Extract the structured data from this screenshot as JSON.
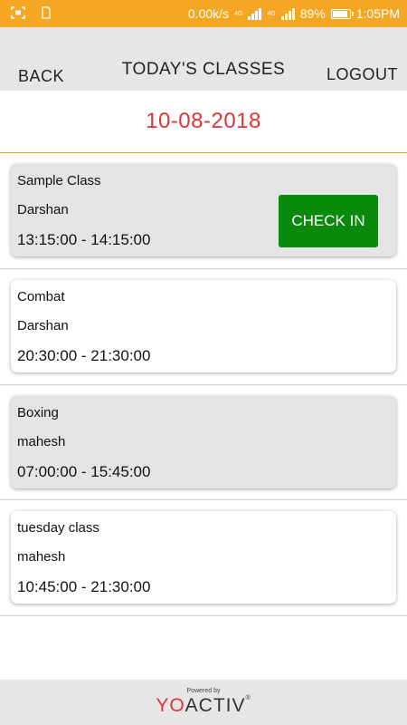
{
  "status_bar": {
    "speed": "0.00k/s",
    "network_a": "4G",
    "network_b": "4G",
    "battery": "89%",
    "time": "1:05PM"
  },
  "header": {
    "back": "BACK",
    "title": "TODAY'S CLASSES",
    "logout": "LOGOUT"
  },
  "date": "10-08-2018",
  "classes": [
    {
      "name": "Sample Class",
      "trainer": "Darshan",
      "time": "13:15:00 - 14:15:00",
      "action": "CHECK IN"
    },
    {
      "name": "Combat",
      "trainer": "Darshan",
      "time": "20:30:00 - 21:30:00"
    },
    {
      "name": "Boxing",
      "trainer": "mahesh",
      "time": "07:00:00 - 15:45:00"
    },
    {
      "name": "tuesday class",
      "trainer": "mahesh",
      "time": "10:45:00 - 21:30:00"
    }
  ],
  "footer": {
    "powered_by": "Powered by",
    "brand_yo": "YO",
    "brand_activ": "ACTIV",
    "reg": "®"
  },
  "colors": {
    "status_bar": "#f5a623",
    "date": "#e03535",
    "check_in": "#0a8a0a"
  }
}
